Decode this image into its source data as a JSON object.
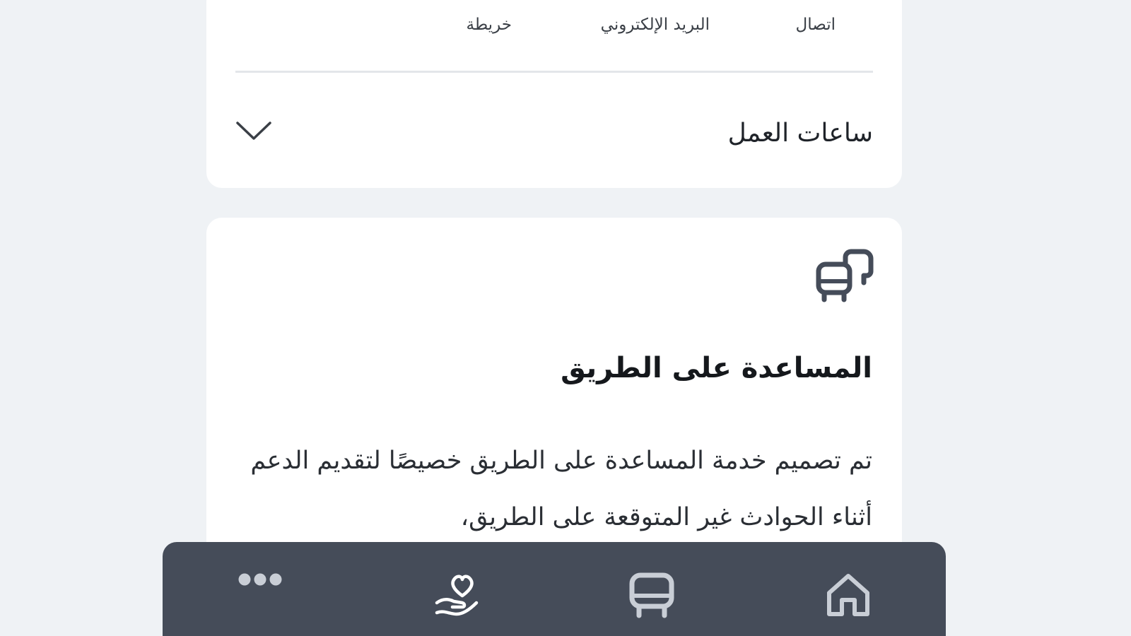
{
  "contact": {
    "call_label": "اتصال",
    "email_label": "البريد الإلكتروني",
    "map_label": "خريطة"
  },
  "hours": {
    "label": "ساعات العمل",
    "icon": "chevron-down-icon"
  },
  "road_assistance": {
    "icon": "vehicles-icon",
    "title": "المساعدة على الطريق",
    "description": "تم تصميم خدمة المساعدة على الطريق خصيصًا لتقديم الدعم أثناء الحوادث غير المتوقعة على الطريق،"
  },
  "bottom_nav": {
    "items": [
      {
        "icon": "more-dots-icon"
      },
      {
        "icon": "care-hand-heart-icon"
      },
      {
        "icon": "bus-icon"
      },
      {
        "icon": "home-icon"
      }
    ]
  },
  "colors": {
    "background": "#eff2f5",
    "card": "#ffffff",
    "nav_background": "#454c59",
    "icon_dark": "#454c59",
    "nav_icon": "#ffffff",
    "nav_icon_muted": "#c9ced6"
  }
}
